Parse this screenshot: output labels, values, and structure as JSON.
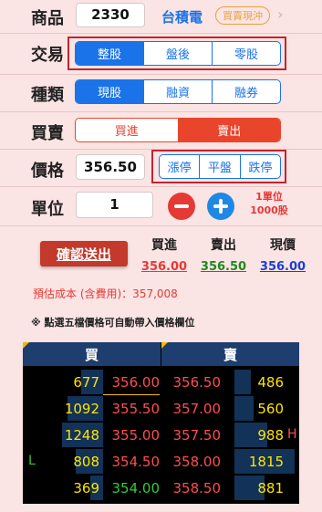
{
  "header": {
    "label": "商品",
    "code": "2330",
    "name": "台積電",
    "tag": "買賣現沖",
    "chevron": "›"
  },
  "trade": {
    "label": "交易",
    "options": [
      "整股",
      "盤後",
      "零股"
    ],
    "selected": "整股"
  },
  "category": {
    "label": "種類",
    "options": [
      "現股",
      "融資",
      "融券"
    ],
    "selected": "現股"
  },
  "side": {
    "label": "買賣",
    "options": [
      "買進",
      "賣出"
    ],
    "selected": "賣出"
  },
  "price": {
    "label": "價格",
    "value": "356.50",
    "quick": [
      "漲停",
      "平盤",
      "跌停"
    ]
  },
  "unit": {
    "label": "單位",
    "value": "1",
    "note_line1": "1單位",
    "note_line2": "1000股"
  },
  "confirm": {
    "label": "確認送出"
  },
  "quote": {
    "buy_label": "買進",
    "buy_value": "356.00",
    "sell_label": "賣出",
    "sell_value": "356.50",
    "last_label": "現價",
    "last_value": "356.00"
  },
  "estimate": "預估成本 (含費用)：357,008",
  "hint": "※ 點選五檔價格可自動帶入價格欄位",
  "book": {
    "buy_header": "買",
    "sell_header": "賣",
    "rows": [
      {
        "bid_vol": "677",
        "bid": "356.00",
        "ask": "356.50",
        "ask_vol": "486",
        "bid_mark": "",
        "ask_mark": ""
      },
      {
        "bid_vol": "1092",
        "bid": "355.50",
        "ask": "357.00",
        "ask_vol": "560",
        "bid_mark": "",
        "ask_mark": ""
      },
      {
        "bid_vol": "1248",
        "bid": "355.00",
        "ask": "357.50",
        "ask_vol": "988",
        "bid_mark": "",
        "ask_mark": "H"
      },
      {
        "bid_vol": "808",
        "bid": "354.50",
        "ask": "358.00",
        "ask_vol": "1815",
        "bid_mark": "L",
        "ask_mark": ""
      },
      {
        "bid_vol": "369",
        "bid": "354.00",
        "ask": "358.50",
        "ask_vol": "881",
        "bid_mark": "",
        "ask_mark": ""
      }
    ],
    "bid_colors": [
      "#ff4d4d",
      "#ff4d4d",
      "#ff4d4d",
      "#ff4d4d",
      "#33cc33"
    ],
    "ask_colors": [
      "#ff4d4d",
      "#ff4d4d",
      "#ff4d4d",
      "#ff4d4d",
      "#ff4d4d"
    ],
    "bid_vol_fill": [
      0.16,
      0.26,
      0.3,
      0.2,
      0.09
    ],
    "ask_vol_fill": [
      0.12,
      0.14,
      0.24,
      0.44,
      0.22
    ]
  },
  "colors": {
    "accent_blue": "#1a73e8",
    "accent_red": "#e8452c",
    "highlight_border": "#c0262e",
    "background": "#fbe4e4",
    "book_header": "#1d3e6e",
    "volume_text": "#ffe400"
  }
}
